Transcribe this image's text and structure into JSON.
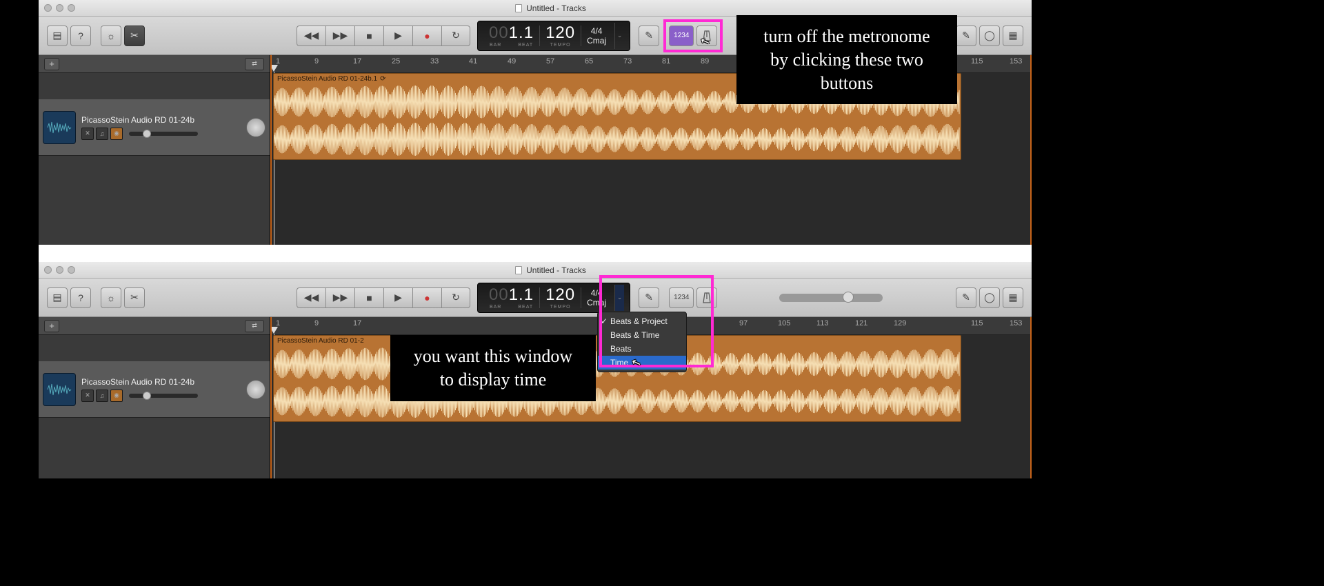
{
  "window_title": "Untitled - Tracks",
  "lcd": {
    "bar_dim": "00",
    "bar": "1.1",
    "bar_label": "BAR",
    "beat_label": "BEAT",
    "tempo": "120",
    "tempo_label": "TEMPO",
    "timesig": "4/4",
    "key": "Cmaj"
  },
  "countoff_label": "1234",
  "track": {
    "name": "PicassoStein Audio RD 01-24b",
    "region_name": "PicassoStein Audio RD 01-24b.1"
  },
  "track2": {
    "region_name": "PicassoStein Audio RD 01-2"
  },
  "ruler_marks": [
    "1",
    "9",
    "17",
    "25",
    "33",
    "41",
    "49",
    "57",
    "65",
    "73",
    "81",
    "89",
    "",
    "",
    "",
    "",
    "",
    "",
    "115",
    "153"
  ],
  "ruler2_marks": [
    "1",
    "9",
    "17",
    "",
    "",
    "",
    "",
    "",
    "",
    "",
    "",
    "",
    "97",
    "105",
    "113",
    "121",
    "129",
    "",
    "115",
    "153"
  ],
  "menu": {
    "items": [
      "Beats & Project",
      "Beats & Time",
      "Beats",
      "Time"
    ],
    "checked": 0,
    "selected": 3
  },
  "annot1": "turn off the metronome by clicking these two buttons",
  "annot2": "you want this window to display time"
}
